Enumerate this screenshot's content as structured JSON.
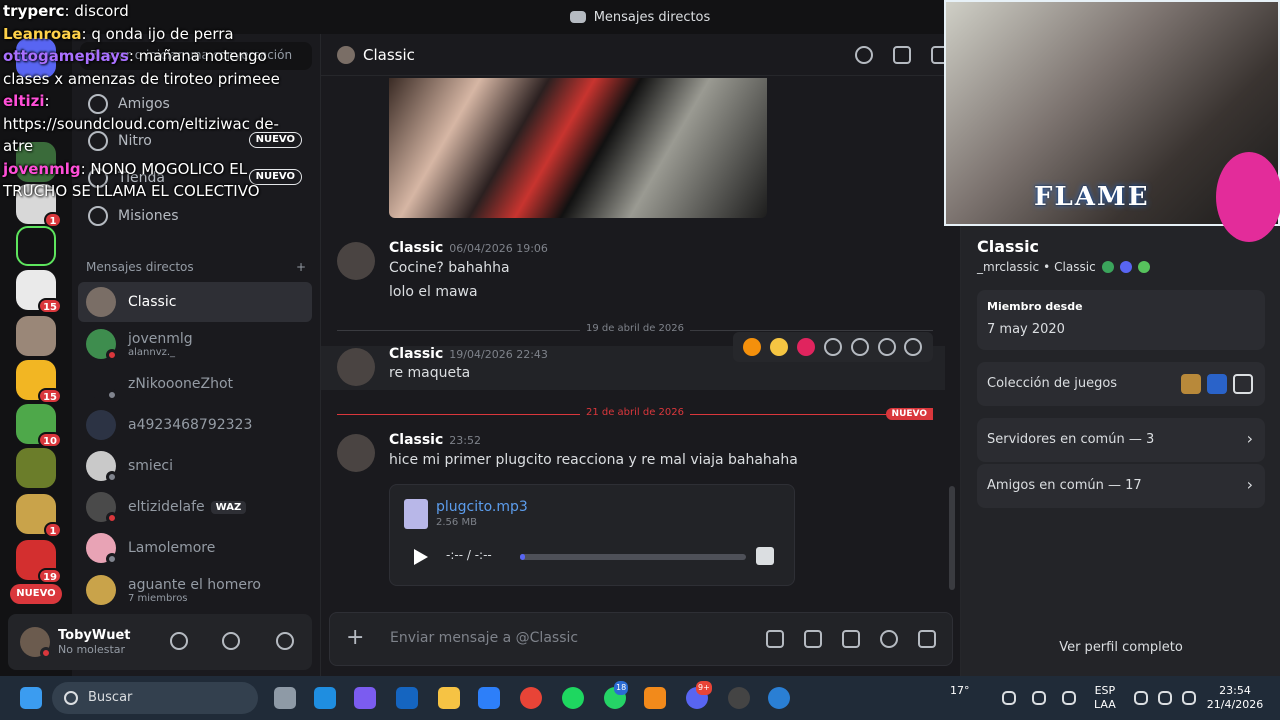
{
  "window": {
    "title": "Mensajes directos"
  },
  "sidebar": {
    "search_placeholder": "Buscar o iniciar una conversación",
    "nav": [
      {
        "label": "Amigos"
      },
      {
        "label": "Nitro",
        "badge": "NUEVO"
      },
      {
        "label": "Tienda",
        "badge": "NUEVO"
      },
      {
        "label": "Misiones"
      }
    ],
    "dm_header": "Mensajes directos",
    "dms": [
      {
        "name": "Classic",
        "sub": ""
      },
      {
        "name": "jovenmlg",
        "sub": "alannvz._"
      },
      {
        "name": "zNikoooneZhot",
        "sub": ""
      },
      {
        "name": "a4923468792323",
        "sub": ""
      },
      {
        "name": "smieci",
        "sub": ""
      },
      {
        "name": "eltizidelafe",
        "sub": "",
        "tag": "WAZ"
      },
      {
        "name": "Lamolemore",
        "sub": ""
      },
      {
        "name": "aguante el homero",
        "sub": "7 miembros"
      }
    ]
  },
  "servers": {
    "badges": [
      "1",
      "15",
      "15",
      "10",
      "1",
      "19"
    ],
    "nuevo": "NUEVO"
  },
  "user": {
    "name": "TobyWuet",
    "status": "No molestar"
  },
  "chat": {
    "title": "Classic",
    "messages": [
      {
        "author": "Classic",
        "time": "06/04/2026 19:06",
        "lines": [
          "Cocine? bahahha",
          "lolo el mawa"
        ]
      },
      {
        "author": "Classic",
        "time": "19/04/2026 22:43",
        "lines": [
          "re maqueta"
        ]
      },
      {
        "author": "Classic",
        "time": "23:52",
        "lines": [
          "hice mi primer plugcito reacciona y re mal viaja bahahaha"
        ]
      }
    ],
    "dividers": {
      "d1": "19 de abril de 2026",
      "d2": "21 de abril de 2026",
      "nuevo": "NUEVO"
    },
    "attachment": {
      "filename": "plugcito.mp3",
      "size": "2.56 MB",
      "time": "-:-- / -:--",
      "progress": 0.02
    },
    "composer_placeholder": "Enviar mensaje a @Classic"
  },
  "profile": {
    "display_name": "Classic",
    "username": "_mrclassic",
    "pronoun_tag": "Classic",
    "member_since_label": "Miembro desde",
    "member_since": "7 may 2020",
    "games_label": "Colección de juegos",
    "servers_common": "Servidores en común — 3",
    "friends_common": "Amigos en común — 17",
    "view_full": "Ver perfil completo"
  },
  "stream_overlay": {
    "webcam_text": "FLAME",
    "lines": [
      {
        "user": "tryperc",
        "text": "discord",
        "color": "#ffffff"
      },
      {
        "user": "Leanroaa",
        "text": "q onda ijo de perra",
        "color": "#ffd24a"
      },
      {
        "user": "ottogameplays",
        "text": "mañana notengo clases x amenzas de tiroteo primeee",
        "color": "#a970ff"
      },
      {
        "user": "eltizi",
        "text": "https://soundcloud.com/eltiziwac de-atre",
        "color": "#ff4fd8"
      },
      {
        "user": "jovenmlg",
        "text": "NONO MOGOLICO EL TRUCHO SE LLAMA EL COLECTIVO",
        "color": "#ff4fd8"
      }
    ]
  },
  "taskbar": {
    "search": "Buscar",
    "temp": "17°",
    "lang": [
      "ESP",
      "LAA"
    ],
    "time": "23:54",
    "date": "21/4/2026",
    "chrome_badge": "18",
    "discord_badge": "9+"
  }
}
